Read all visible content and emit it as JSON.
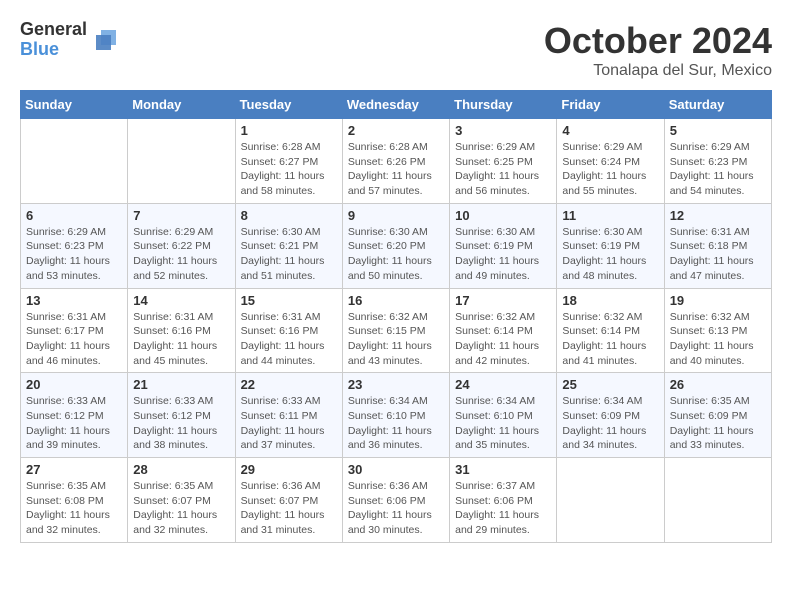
{
  "logo": {
    "general": "General",
    "blue": "Blue"
  },
  "title": "October 2024",
  "location": "Tonalapa del Sur, Mexico",
  "headers": [
    "Sunday",
    "Monday",
    "Tuesday",
    "Wednesday",
    "Thursday",
    "Friday",
    "Saturday"
  ],
  "weeks": [
    [
      {
        "day": "",
        "info": ""
      },
      {
        "day": "",
        "info": ""
      },
      {
        "day": "1",
        "info": "Sunrise: 6:28 AM\nSunset: 6:27 PM\nDaylight: 11 hours and 58 minutes."
      },
      {
        "day": "2",
        "info": "Sunrise: 6:28 AM\nSunset: 6:26 PM\nDaylight: 11 hours and 57 minutes."
      },
      {
        "day": "3",
        "info": "Sunrise: 6:29 AM\nSunset: 6:25 PM\nDaylight: 11 hours and 56 minutes."
      },
      {
        "day": "4",
        "info": "Sunrise: 6:29 AM\nSunset: 6:24 PM\nDaylight: 11 hours and 55 minutes."
      },
      {
        "day": "5",
        "info": "Sunrise: 6:29 AM\nSunset: 6:23 PM\nDaylight: 11 hours and 54 minutes."
      }
    ],
    [
      {
        "day": "6",
        "info": "Sunrise: 6:29 AM\nSunset: 6:23 PM\nDaylight: 11 hours and 53 minutes."
      },
      {
        "day": "7",
        "info": "Sunrise: 6:29 AM\nSunset: 6:22 PM\nDaylight: 11 hours and 52 minutes."
      },
      {
        "day": "8",
        "info": "Sunrise: 6:30 AM\nSunset: 6:21 PM\nDaylight: 11 hours and 51 minutes."
      },
      {
        "day": "9",
        "info": "Sunrise: 6:30 AM\nSunset: 6:20 PM\nDaylight: 11 hours and 50 minutes."
      },
      {
        "day": "10",
        "info": "Sunrise: 6:30 AM\nSunset: 6:19 PM\nDaylight: 11 hours and 49 minutes."
      },
      {
        "day": "11",
        "info": "Sunrise: 6:30 AM\nSunset: 6:19 PM\nDaylight: 11 hours and 48 minutes."
      },
      {
        "day": "12",
        "info": "Sunrise: 6:31 AM\nSunset: 6:18 PM\nDaylight: 11 hours and 47 minutes."
      }
    ],
    [
      {
        "day": "13",
        "info": "Sunrise: 6:31 AM\nSunset: 6:17 PM\nDaylight: 11 hours and 46 minutes."
      },
      {
        "day": "14",
        "info": "Sunrise: 6:31 AM\nSunset: 6:16 PM\nDaylight: 11 hours and 45 minutes."
      },
      {
        "day": "15",
        "info": "Sunrise: 6:31 AM\nSunset: 6:16 PM\nDaylight: 11 hours and 44 minutes."
      },
      {
        "day": "16",
        "info": "Sunrise: 6:32 AM\nSunset: 6:15 PM\nDaylight: 11 hours and 43 minutes."
      },
      {
        "day": "17",
        "info": "Sunrise: 6:32 AM\nSunset: 6:14 PM\nDaylight: 11 hours and 42 minutes."
      },
      {
        "day": "18",
        "info": "Sunrise: 6:32 AM\nSunset: 6:14 PM\nDaylight: 11 hours and 41 minutes."
      },
      {
        "day": "19",
        "info": "Sunrise: 6:32 AM\nSunset: 6:13 PM\nDaylight: 11 hours and 40 minutes."
      }
    ],
    [
      {
        "day": "20",
        "info": "Sunrise: 6:33 AM\nSunset: 6:12 PM\nDaylight: 11 hours and 39 minutes."
      },
      {
        "day": "21",
        "info": "Sunrise: 6:33 AM\nSunset: 6:12 PM\nDaylight: 11 hours and 38 minutes."
      },
      {
        "day": "22",
        "info": "Sunrise: 6:33 AM\nSunset: 6:11 PM\nDaylight: 11 hours and 37 minutes."
      },
      {
        "day": "23",
        "info": "Sunrise: 6:34 AM\nSunset: 6:10 PM\nDaylight: 11 hours and 36 minutes."
      },
      {
        "day": "24",
        "info": "Sunrise: 6:34 AM\nSunset: 6:10 PM\nDaylight: 11 hours and 35 minutes."
      },
      {
        "day": "25",
        "info": "Sunrise: 6:34 AM\nSunset: 6:09 PM\nDaylight: 11 hours and 34 minutes."
      },
      {
        "day": "26",
        "info": "Sunrise: 6:35 AM\nSunset: 6:09 PM\nDaylight: 11 hours and 33 minutes."
      }
    ],
    [
      {
        "day": "27",
        "info": "Sunrise: 6:35 AM\nSunset: 6:08 PM\nDaylight: 11 hours and 32 minutes."
      },
      {
        "day": "28",
        "info": "Sunrise: 6:35 AM\nSunset: 6:07 PM\nDaylight: 11 hours and 32 minutes."
      },
      {
        "day": "29",
        "info": "Sunrise: 6:36 AM\nSunset: 6:07 PM\nDaylight: 11 hours and 31 minutes."
      },
      {
        "day": "30",
        "info": "Sunrise: 6:36 AM\nSunset: 6:06 PM\nDaylight: 11 hours and 30 minutes."
      },
      {
        "day": "31",
        "info": "Sunrise: 6:37 AM\nSunset: 6:06 PM\nDaylight: 11 hours and 29 minutes."
      },
      {
        "day": "",
        "info": ""
      },
      {
        "day": "",
        "info": ""
      }
    ]
  ]
}
